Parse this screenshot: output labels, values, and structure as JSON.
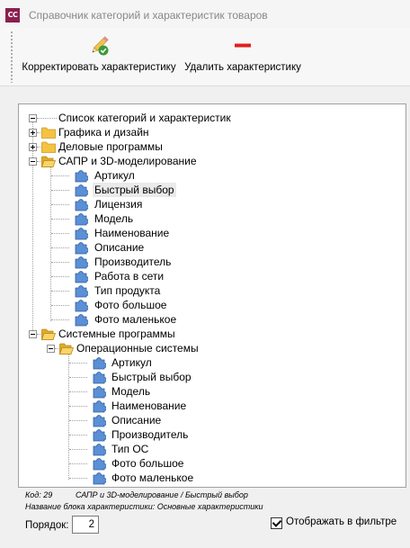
{
  "window": {
    "title": "Справочник категорий и характеристик товаров",
    "app_icon_text": "CC",
    "app_icon_color": "#8b1f4f"
  },
  "toolbar": {
    "edit_label": "Корректировать характеристику",
    "edit_icon": "pencil-check-icon",
    "delete_label": "Удалить характеристику",
    "delete_icon": "minus-icon",
    "delete_icon_color": "#e02020"
  },
  "tree": {
    "root": "Список категорий и характеристик",
    "graphics": "Графика и дизайн",
    "business": "Деловые программы",
    "cad": "САПР и 3D-моделирование",
    "cad_items": [
      "Артикул",
      "Быстрый выбор",
      "Лицензия",
      "Модель",
      "Наименование",
      "Описание",
      "Производитель",
      "Работа в сети",
      "Тип продукта",
      "Фото большое",
      "Фото маленькое"
    ],
    "cad_selected_item": "Быстрый выбор",
    "system": "Системные программы",
    "os": "Операционные системы",
    "os_items": [
      "Артикул",
      "Быстрый выбор",
      "Модель",
      "Наименование",
      "Описание",
      "Производитель",
      "Тип ОС",
      "Фото большое",
      "Фото маленькое"
    ]
  },
  "info": {
    "code_label": "Код: 29",
    "path": "САПР и 3D-моделирование / Быстрый выбор",
    "block_name": "Название блока характеристики: Основные характеристики"
  },
  "order": {
    "label": "Порядок:",
    "value": "2"
  },
  "filter": {
    "label": "Отображать в фильтре",
    "checked": true
  },
  "colors": {
    "folder": "#f5c242",
    "puzzle": "#5b8fd6"
  }
}
